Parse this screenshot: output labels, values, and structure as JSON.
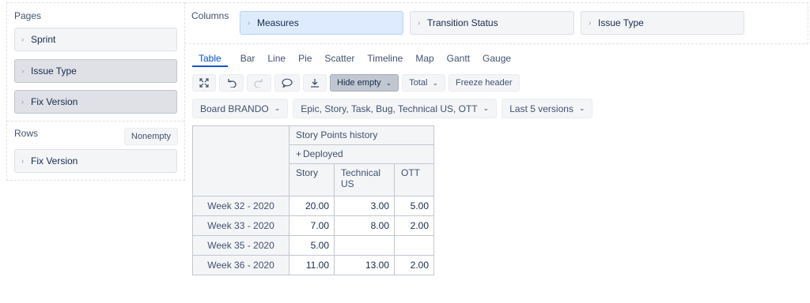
{
  "pages": {
    "title": "Pages",
    "items": [
      "Sprint",
      "Issue Type",
      "Fix Version"
    ]
  },
  "rows": {
    "title": "Rows",
    "nonempty_label": "Nonempty",
    "items": [
      "Fix Version"
    ]
  },
  "columns": {
    "title": "Columns",
    "items": [
      "Measures",
      "Transition Status",
      "Issue Type"
    ]
  },
  "tabs": [
    "Table",
    "Bar",
    "Line",
    "Pie",
    "Scatter",
    "Timeline",
    "Map",
    "Gantt",
    "Gauge"
  ],
  "toolbar": {
    "hide_empty": "Hide empty",
    "total": "Total",
    "freeze_header": "Freeze header"
  },
  "filters": [
    "Board BRANDO",
    "Epic, Story, Task, Bug, Technical US, OTT",
    "Last 5 versions"
  ],
  "table": {
    "measure_header": "Story Points history",
    "status_header": "Deployed",
    "columns": [
      "Story",
      "Technical US",
      "OTT"
    ],
    "rows": [
      {
        "label": "Week 32 - 2020",
        "values": [
          "20.00",
          "3.00",
          "5.00"
        ]
      },
      {
        "label": "Week 33 - 2020",
        "values": [
          "7.00",
          "8.00",
          "2.00"
        ]
      },
      {
        "label": "Week 35 - 2020",
        "values": [
          "5.00",
          "",
          ""
        ]
      },
      {
        "label": "Week 36 - 2020",
        "values": [
          "11.00",
          "13.00",
          "2.00"
        ]
      }
    ]
  },
  "colors": {
    "accent": "#0052cc",
    "selected_chip": "#deebff",
    "chip_bg": "#f4f5f7",
    "border": "#c1c7d0"
  }
}
